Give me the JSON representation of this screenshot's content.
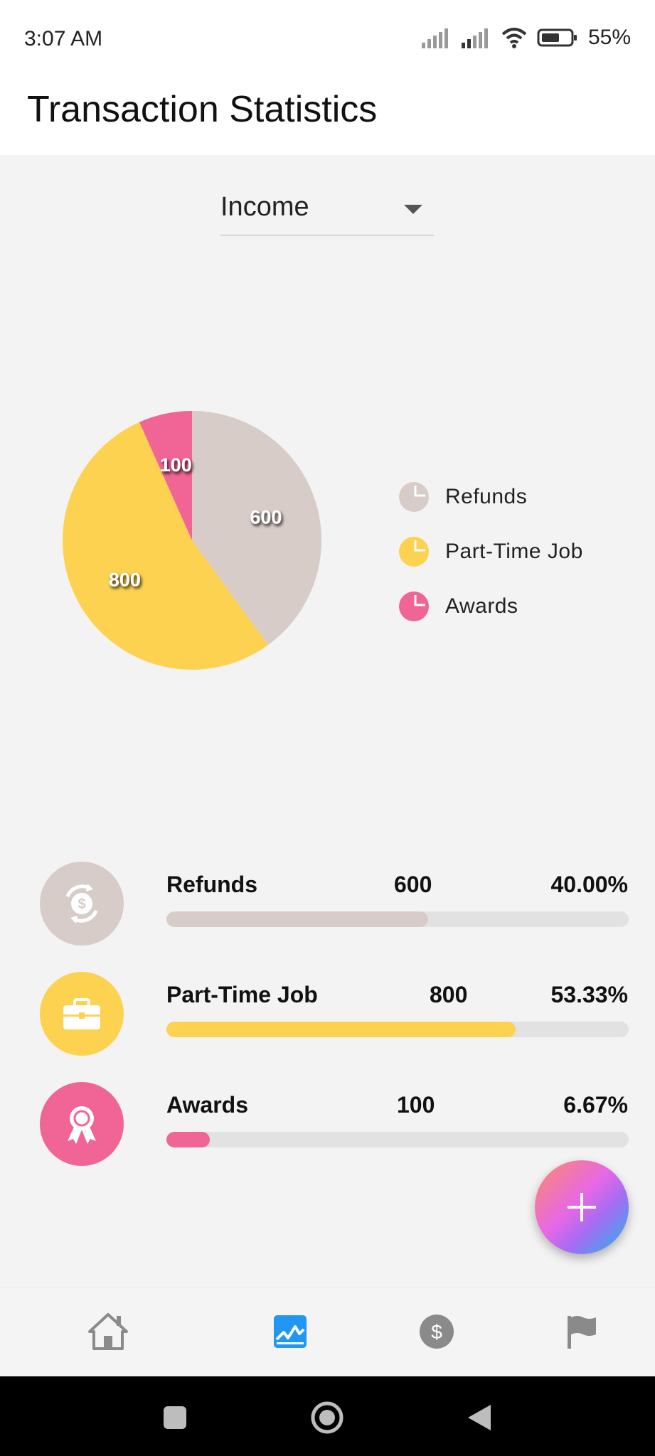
{
  "status_bar": {
    "time": "3:07 AM",
    "battery_text": "55%",
    "icons": [
      "signal-icon",
      "signal-icon",
      "wifi-icon",
      "battery-icon"
    ]
  },
  "app_bar": {
    "title": "Transaction Statistics"
  },
  "filter": {
    "selected": "Income",
    "icon": "dropdown-arrow-icon"
  },
  "chart_data": {
    "type": "pie",
    "slices": [
      {
        "label": "Refunds",
        "value": 600,
        "color": "#d8ccc8"
      },
      {
        "label": "Part-Time Job",
        "value": 800,
        "color": "#fdd251"
      },
      {
        "label": "Awards",
        "value": 100,
        "color": "#f06595"
      }
    ],
    "data_labels": [
      "600",
      "800",
      "100"
    ],
    "legend_position": "right"
  },
  "legend": {
    "items": [
      {
        "label": "Refunds",
        "color": "#d8ccc8",
        "icon": "pie-slice-icon"
      },
      {
        "label": "Part-Time Job",
        "color": "#fdd251",
        "icon": "pie-slice-icon"
      },
      {
        "label": "Awards",
        "color": "#f06595",
        "icon": "pie-slice-icon"
      }
    ]
  },
  "stats": {
    "rows": [
      {
        "name": "Refunds",
        "amount": "600",
        "percent": "40.00%",
        "progress": 0.5667,
        "color": "#d8ccc8",
        "icon": "refund-icon"
      },
      {
        "name": "Part-Time Job",
        "amount": "800",
        "percent": "53.33%",
        "progress": 0.7556,
        "color": "#fdd251",
        "icon": "briefcase-icon"
      },
      {
        "name": "Awards",
        "amount": "100",
        "percent": "6.67%",
        "progress": 0.0944,
        "color": "#f06595",
        "icon": "award-icon"
      }
    ]
  },
  "fab": {
    "icon": "plus-icon"
  },
  "bottom_nav": {
    "items": [
      {
        "name": "home",
        "icon": "home-icon",
        "active": false
      },
      {
        "name": "statistics",
        "icon": "chart-icon",
        "active": true
      },
      {
        "name": "transactions",
        "icon": "dollar-icon",
        "active": false
      },
      {
        "name": "goals",
        "icon": "flag-icon",
        "active": false
      }
    ],
    "active_color": "#2196f3",
    "inactive_color": "#8a8a8a"
  },
  "system_nav": {
    "icons": [
      "recents-icon",
      "home-circle-icon",
      "back-icon"
    ]
  }
}
